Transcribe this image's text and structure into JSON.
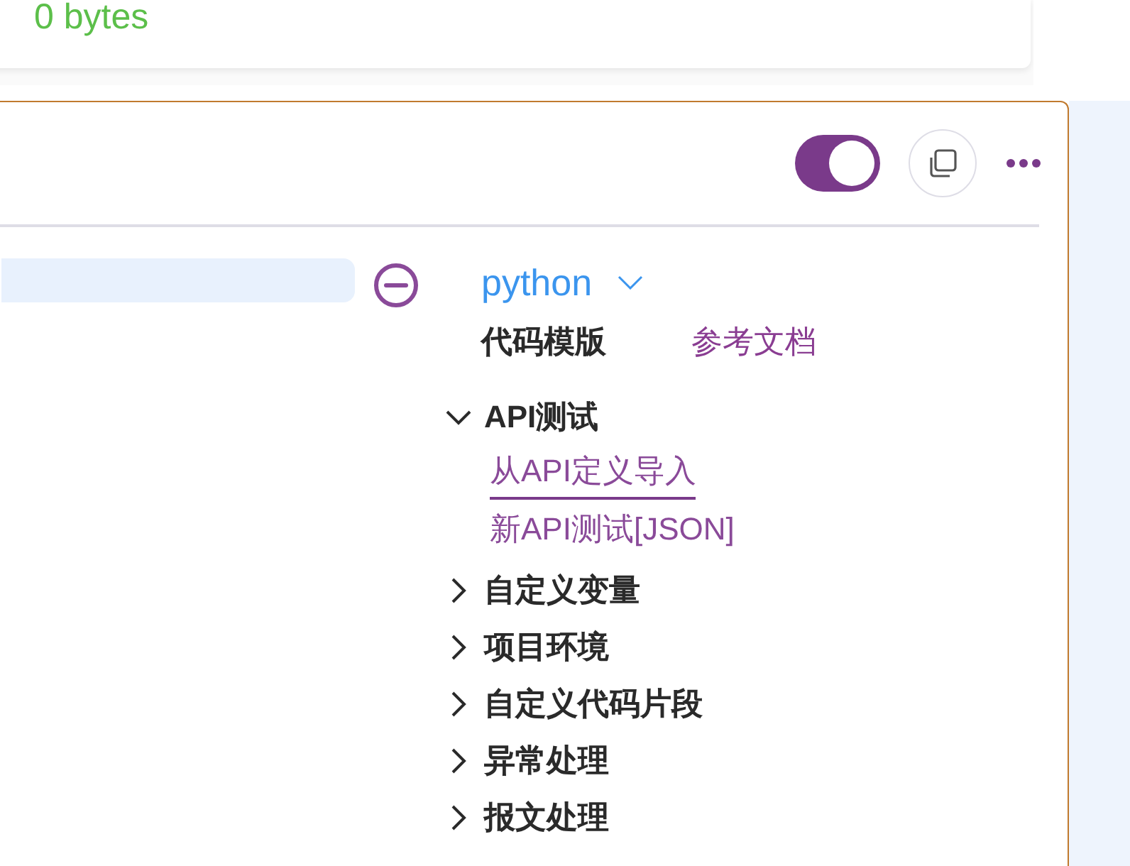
{
  "size_label": "0 bytes",
  "toolbar": {
    "toggle": {
      "on": true
    }
  },
  "language": {
    "value": "python"
  },
  "template": {
    "title": "代码模版",
    "link": "参考文档"
  },
  "tree": [
    {
      "label": "API测试",
      "expanded": true,
      "children": [
        {
          "label": "从API定义导入",
          "selected": true
        },
        {
          "label": "新API测试[JSON]",
          "selected": false
        }
      ]
    },
    {
      "label": "自定义变量",
      "expanded": false
    },
    {
      "label": "项目环境",
      "expanded": false
    },
    {
      "label": "自定义代码片段",
      "expanded": false
    },
    {
      "label": "异常处理",
      "expanded": false
    },
    {
      "label": "报文处理",
      "expanded": false
    }
  ]
}
